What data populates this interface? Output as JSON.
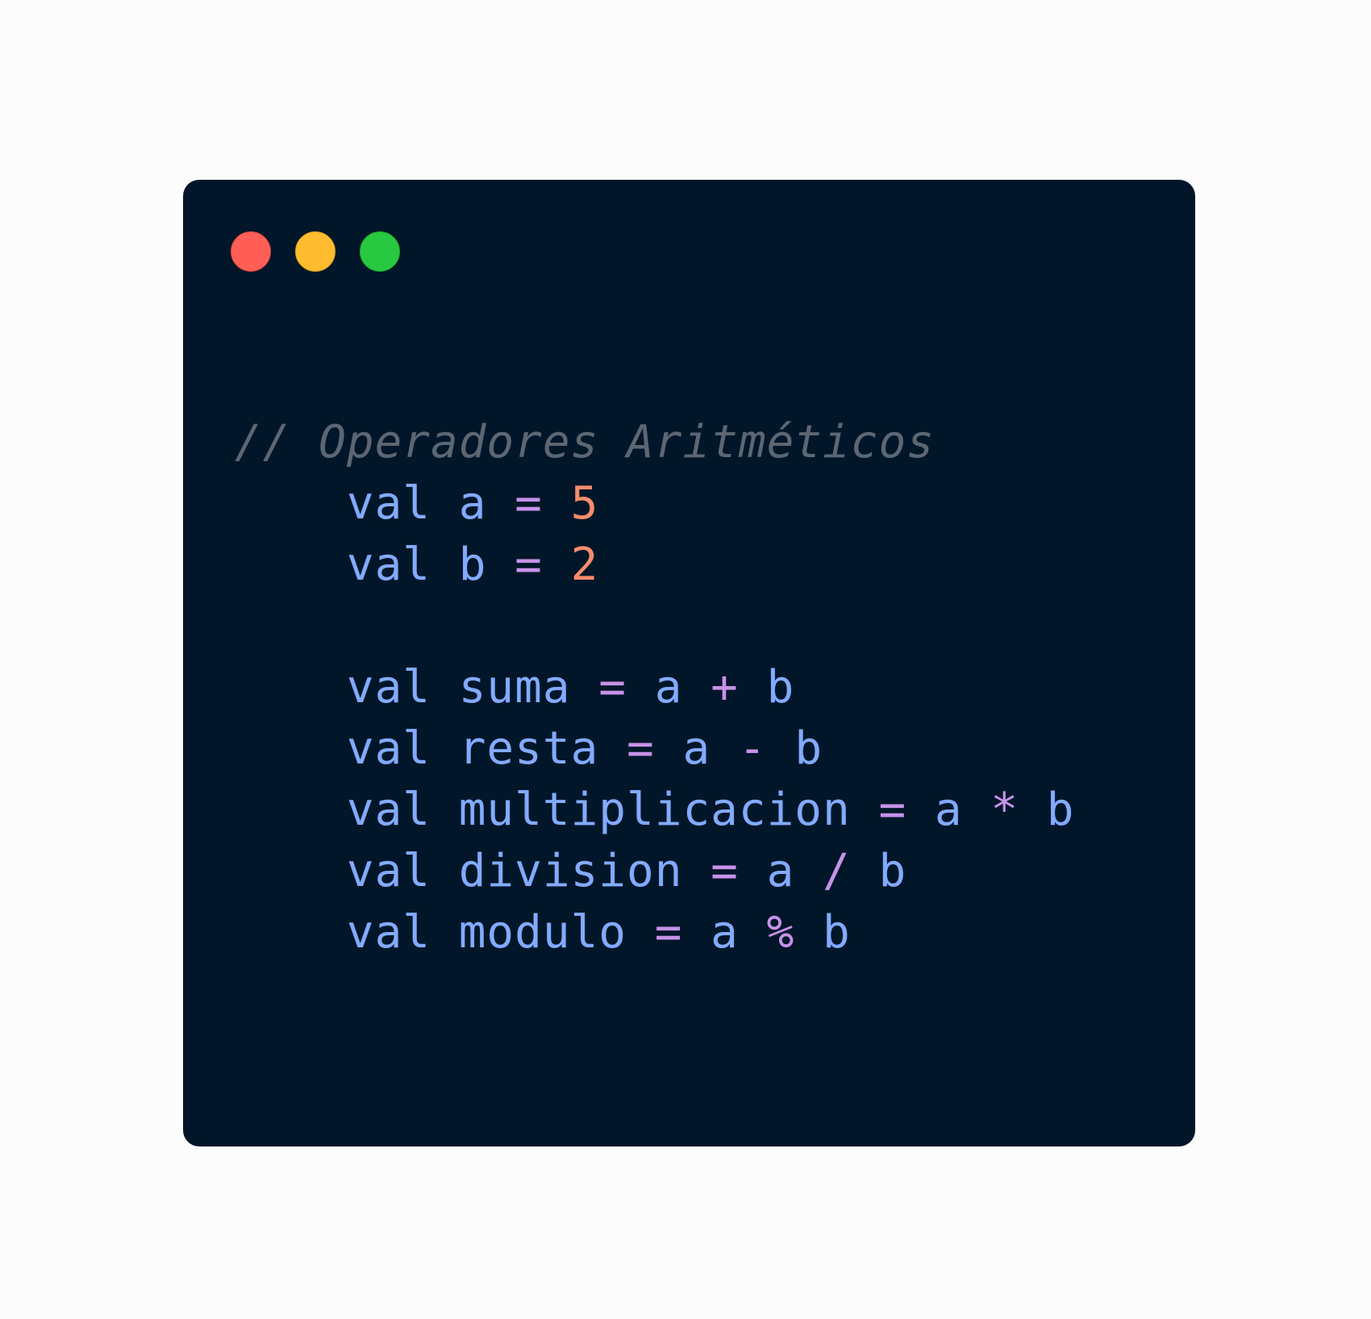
{
  "window": {
    "controls": [
      {
        "name": "close",
        "color": "#ff5f57"
      },
      {
        "name": "minimize",
        "color": "#febc2e"
      },
      {
        "name": "maximize",
        "color": "#28c840"
      }
    ]
  },
  "code": {
    "lines": [
      {
        "tokens": [
          {
            "type": "comment",
            "text": "// Operadores Aritméticos"
          }
        ]
      },
      {
        "tokens": [
          {
            "type": "ident",
            "text": "    val a "
          },
          {
            "type": "op",
            "text": "="
          },
          {
            "type": "ident",
            "text": " "
          },
          {
            "type": "num",
            "text": "5"
          }
        ]
      },
      {
        "tokens": [
          {
            "type": "ident",
            "text": "    val b "
          },
          {
            "type": "op",
            "text": "="
          },
          {
            "type": "ident",
            "text": " "
          },
          {
            "type": "num",
            "text": "2"
          }
        ]
      },
      {
        "tokens": [
          {
            "type": "ident",
            "text": ""
          }
        ]
      },
      {
        "tokens": [
          {
            "type": "ident",
            "text": "    val suma "
          },
          {
            "type": "op",
            "text": "="
          },
          {
            "type": "ident",
            "text": " a "
          },
          {
            "type": "op",
            "text": "+"
          },
          {
            "type": "ident",
            "text": " b"
          }
        ]
      },
      {
        "tokens": [
          {
            "type": "ident",
            "text": "    val resta "
          },
          {
            "type": "op",
            "text": "="
          },
          {
            "type": "ident",
            "text": " a "
          },
          {
            "type": "op",
            "text": "-"
          },
          {
            "type": "ident",
            "text": " b"
          }
        ]
      },
      {
        "tokens": [
          {
            "type": "ident",
            "text": "    val multiplicacion "
          },
          {
            "type": "op",
            "text": "="
          },
          {
            "type": "ident",
            "text": " a "
          },
          {
            "type": "op",
            "text": "*"
          },
          {
            "type": "ident",
            "text": " b"
          }
        ]
      },
      {
        "tokens": [
          {
            "type": "ident",
            "text": "    val division "
          },
          {
            "type": "op",
            "text": "="
          },
          {
            "type": "ident",
            "text": " a "
          },
          {
            "type": "op",
            "text": "/"
          },
          {
            "type": "ident",
            "text": " b"
          }
        ]
      },
      {
        "tokens": [
          {
            "type": "ident",
            "text": "    val modulo "
          },
          {
            "type": "op",
            "text": "="
          },
          {
            "type": "ident",
            "text": " a "
          },
          {
            "type": "op",
            "text": "%"
          },
          {
            "type": "ident",
            "text": " b"
          }
        ]
      }
    ]
  },
  "colors": {
    "window_bg": "#021629",
    "page_bg": "#fcfcfc",
    "comment": "#5c6773",
    "identifier": "#82aaff",
    "operator": "#c792ea",
    "number": "#f78c6c"
  }
}
